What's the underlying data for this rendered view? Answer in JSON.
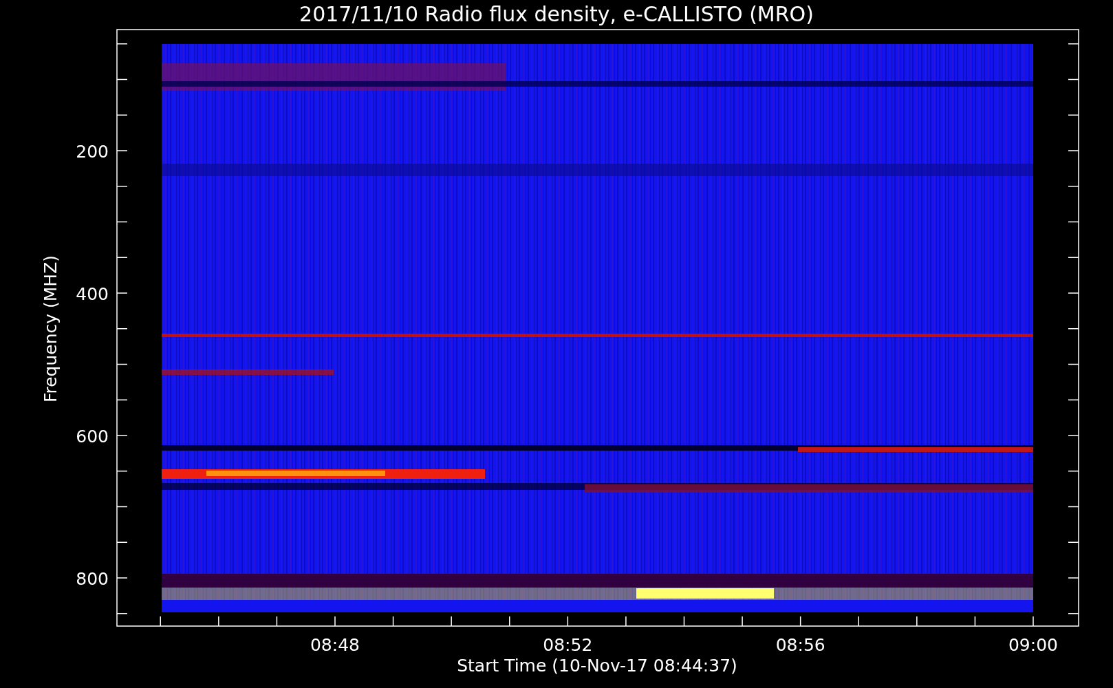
{
  "title": "2017/11/10  Radio flux density, e-CALLISTO (MRO)",
  "y_axis": {
    "label": "Frequency (MHZ)",
    "ticks": [
      "200",
      "400",
      "600",
      "800"
    ]
  },
  "x_axis": {
    "label": "Start Time (10-Nov-17 08:44:37)",
    "ticks": [
      "08:48",
      "08:52",
      "08:56",
      "09:00"
    ]
  }
}
